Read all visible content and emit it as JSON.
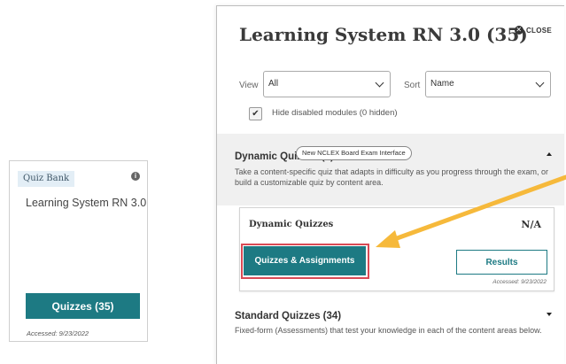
{
  "card": {
    "tag": "Quiz Bank",
    "title": "Learning System RN 3.0",
    "button_label": "Quizzes (35)",
    "accessed": "Accessed: 9/23/2022"
  },
  "modal": {
    "title": "Learning System RN 3.0 (35)",
    "close_label": "CLOSE",
    "view_label": "View",
    "view_value": "All",
    "sort_label": "Sort",
    "sort_value": "Name",
    "checkbox_label": "Hide disabled modules (0 hidden)",
    "checkbox_checked": true,
    "dynamic": {
      "title": "Dynamic Quizzes (1)",
      "tooltip": "New NCLEX Board Exam Interface",
      "description": "Take a content-specific quiz that adapts in difficulty as you progress through the exam, or build a customizable quiz by content area.",
      "item": {
        "title": "Dynamic Quizzes",
        "score": "N/A",
        "primary_button": "Quizzes & Assignments",
        "secondary_button": "Results",
        "accessed": "Accessed: 9/23/2022"
      }
    },
    "standard": {
      "title": "Standard Quizzes (34)",
      "description": "Fixed-form (Assessments) that test your knowledge in each of the content areas below."
    }
  },
  "colors": {
    "teal": "#1d7a83",
    "highlight_red": "#d94a55",
    "arrow_orange": "#f6b93b"
  }
}
